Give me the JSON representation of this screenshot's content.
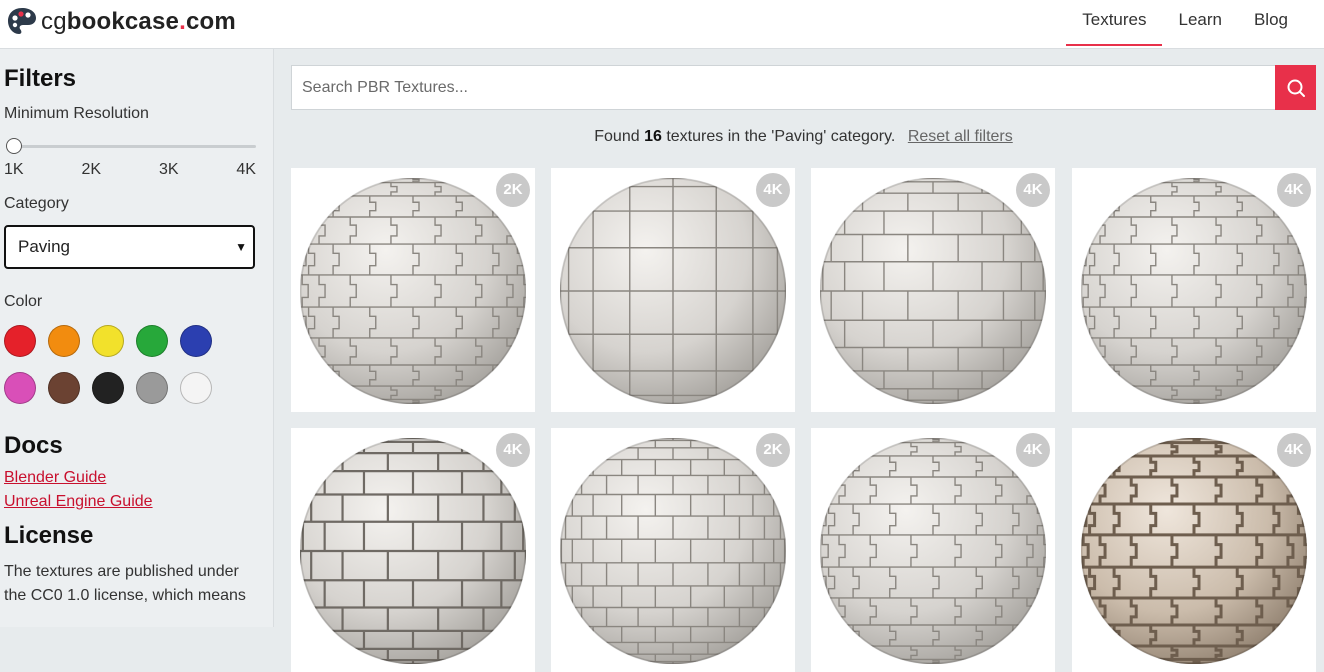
{
  "header": {
    "logo": {
      "cg": "cg",
      "bookcase": "bookcase",
      "dot": ".",
      "com": "com"
    },
    "nav": [
      {
        "label": "Textures",
        "active": true
      },
      {
        "label": "Learn",
        "active": false
      },
      {
        "label": "Blog",
        "active": false
      }
    ],
    "accent_color": "#e8304a"
  },
  "sidebar": {
    "filters_title": "Filters",
    "min_res_label": "Minimum Resolution",
    "resolution_ticks": [
      "1K",
      "2K",
      "3K",
      "4K"
    ],
    "resolution_value": "1K",
    "category_label": "Category",
    "category_value": "Paving",
    "color_label": "Color",
    "colors": [
      {
        "name": "red",
        "hex": "#e5212a"
      },
      {
        "name": "orange",
        "hex": "#f28c0f"
      },
      {
        "name": "yellow",
        "hex": "#f2e12b"
      },
      {
        "name": "green",
        "hex": "#27a83a"
      },
      {
        "name": "blue",
        "hex": "#2b3fb0"
      },
      {
        "name": "pink",
        "hex": "#d94fb8"
      },
      {
        "name": "brown",
        "hex": "#6b4232"
      },
      {
        "name": "black",
        "hex": "#222222"
      },
      {
        "name": "gray",
        "hex": "#9a9a9a"
      },
      {
        "name": "white",
        "hex": "#f4f4f4"
      }
    ],
    "docs_title": "Docs",
    "docs_links": [
      "Blender Guide",
      "Unreal Engine Guide"
    ],
    "license_title": "License",
    "license_text": "The textures are published under the CC0 1.0 license, which means"
  },
  "search": {
    "placeholder": "Search PBR Textures...",
    "icon": "search-icon"
  },
  "results": {
    "prefix": "Found",
    "count": "16",
    "suffix": "textures in the 'Paving' category.",
    "reset_label": "Reset all filters"
  },
  "textures": [
    {
      "resolution": "2K",
      "pattern": "interlock"
    },
    {
      "resolution": "4K",
      "pattern": "square"
    },
    {
      "resolution": "4K",
      "pattern": "brick"
    },
    {
      "resolution": "4K",
      "pattern": "zigzag"
    },
    {
      "resolution": "4K",
      "pattern": "brick-dark"
    },
    {
      "resolution": "2K",
      "pattern": "brick-small"
    },
    {
      "resolution": "4K",
      "pattern": "interlock"
    },
    {
      "resolution": "4K",
      "pattern": "zigzag-rough"
    }
  ]
}
